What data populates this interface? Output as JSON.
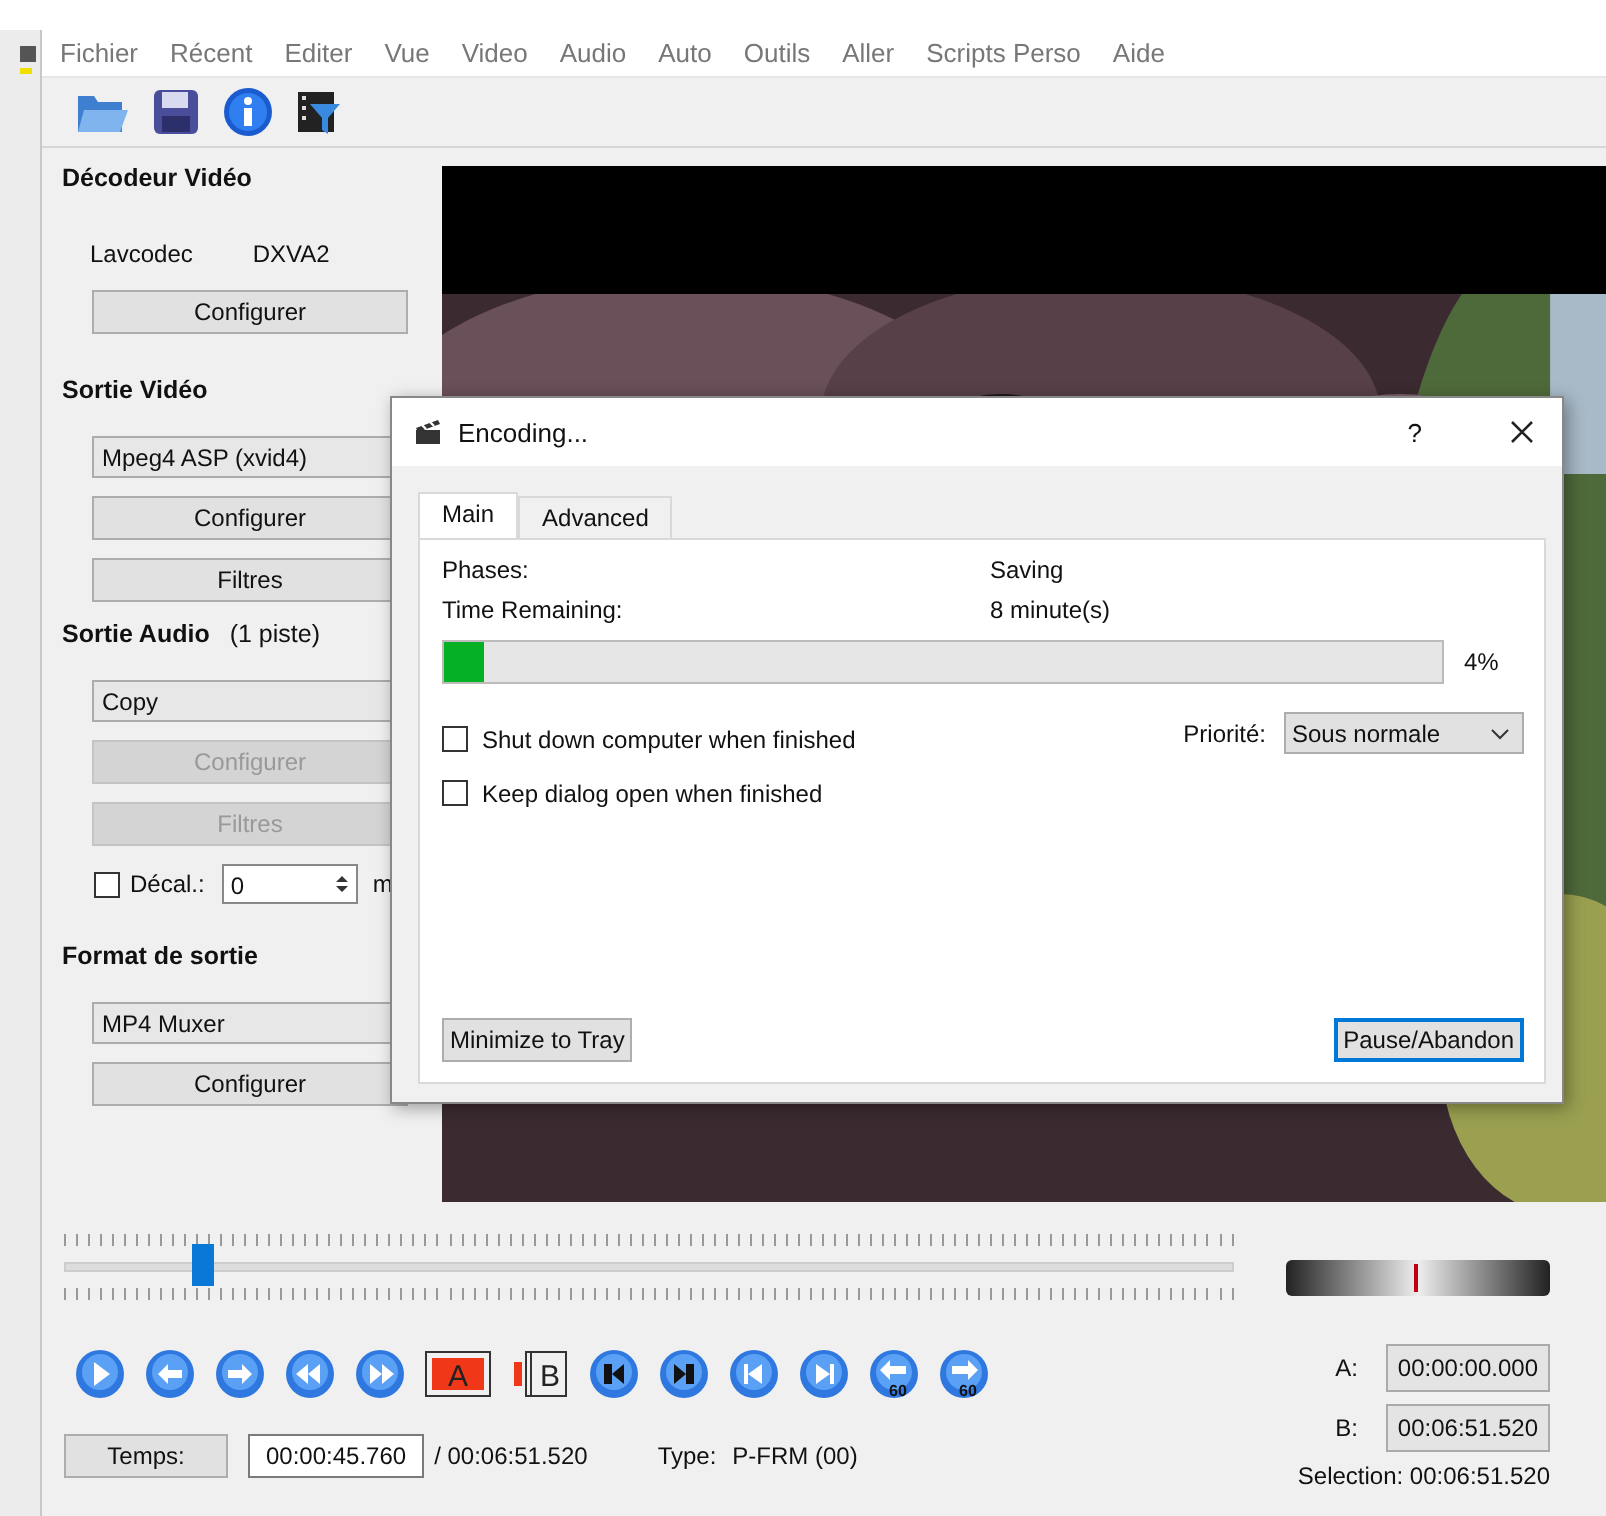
{
  "menu": [
    "Fichier",
    "Récent",
    "Editer",
    "Vue",
    "Video",
    "Audio",
    "Auto",
    "Outils",
    "Aller",
    "Scripts Perso",
    "Aide"
  ],
  "decoder": {
    "title": "Décodeur Vidéo",
    "name": "Lavcodec",
    "accel": "DXVA2",
    "button": "Configurer"
  },
  "video_output": {
    "title": "Sortie Vidéo",
    "codec": "Mpeg4 ASP (xvid4)",
    "buttons": [
      {
        "label": "Configurer",
        "disabled": false
      },
      {
        "label": "Filtres",
        "disabled": false
      }
    ]
  },
  "audio_output": {
    "title": "Sortie Audio",
    "tracks": "(1 piste)",
    "codec": "Copy",
    "buttons": [
      {
        "label": "Configurer",
        "disabled": true
      },
      {
        "label": "Filtres",
        "disabled": true
      }
    ],
    "shift": {
      "label": "Décal.:",
      "checked": false,
      "value": "0",
      "unit": "m"
    }
  },
  "output_format": {
    "title": "Format de sortie",
    "muxer": "MP4 Muxer",
    "button": "Configurer"
  },
  "dialog": {
    "title": "Encoding...",
    "help": "?",
    "tabs": [
      {
        "label": "Main",
        "selected": true
      },
      {
        "label": "Advanced",
        "selected": false
      }
    ],
    "phase_label": "Phases:",
    "phase": "Saving",
    "remaining_label": "Time Remaining:",
    "remaining": "8 minute(s)",
    "progress": {
      "level": 0.04,
      "reading": "4%"
    },
    "options": [
      {
        "label": "Shut down computer when finished",
        "checked": false
      },
      {
        "label": "Keep dialog open when finished",
        "checked": false
      }
    ],
    "priority_label": "Priorité:",
    "priority": "Sous normale",
    "buttons": [
      {
        "label": "Minimize to Tray",
        "default": false
      },
      {
        "label": "Pause/Abandon",
        "default": true
      }
    ]
  },
  "timeline": {
    "level": 0.116
  },
  "transport": {
    "mark_a": "A",
    "mark_b": "B",
    "back_label": "60",
    "forward_label": "60"
  },
  "status": {
    "time_button": "Temps:",
    "time": "00:00:45.760",
    "duration": "/ 00:06:51.520",
    "type_label": "Type:",
    "type_value": "P-FRM (00)"
  },
  "selection": {
    "a_label": "A:",
    "a_value": "00:00:00.000",
    "b_label": "B:",
    "b_value": "00:06:51.520",
    "summary": "Selection: 00:06:51.520"
  }
}
